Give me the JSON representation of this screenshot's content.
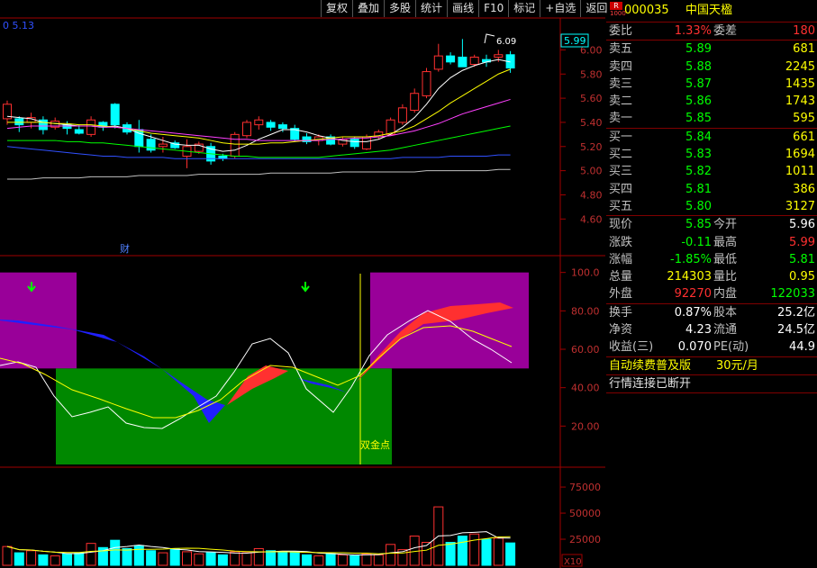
{
  "toolbar": [
    "复权",
    "叠加",
    "多股",
    "统计",
    "画线",
    "F10",
    "标记",
    "+自选",
    "返回"
  ],
  "chart": {
    "ma_label": "0  5.13",
    "last_price_tag": "5.99",
    "high_marker": "6.09",
    "finance_marker": "财",
    "price_axis": [
      "6.00",
      "5.80",
      "5.60",
      "5.40",
      "5.20",
      "5.00",
      "4.80",
      "4.60"
    ],
    "indicator_axis": [
      "100.0",
      "80.00",
      "60.00",
      "40.00",
      "20.00"
    ],
    "cross_label": "双金点",
    "volume_axis": [
      "75000",
      "50000",
      "25000"
    ],
    "volume_unit": "X10"
  },
  "stock": {
    "code": "000035",
    "name": "中国天楹",
    "badge_r": "R",
    "badge_n": "1000"
  },
  "ratio": {
    "l1": "委比",
    "v1": "1.33%",
    "l2": "委差",
    "v2": "180"
  },
  "asks": [
    {
      "label": "卖五",
      "price": "5.89",
      "vol": "681"
    },
    {
      "label": "卖四",
      "price": "5.88",
      "vol": "2245"
    },
    {
      "label": "卖三",
      "price": "5.87",
      "vol": "1435"
    },
    {
      "label": "卖二",
      "price": "5.86",
      "vol": "1743"
    },
    {
      "label": "卖一",
      "price": "5.85",
      "vol": "595"
    }
  ],
  "bids": [
    {
      "label": "买一",
      "price": "5.84",
      "vol": "661"
    },
    {
      "label": "买二",
      "price": "5.83",
      "vol": "1694"
    },
    {
      "label": "买三",
      "price": "5.82",
      "vol": "1011"
    },
    {
      "label": "买四",
      "price": "5.81",
      "vol": "386"
    },
    {
      "label": "买五",
      "price": "5.80",
      "vol": "3127"
    }
  ],
  "quote": [
    {
      "l1": "现价",
      "v1": "5.85",
      "c1": "green",
      "l2": "今开",
      "v2": "5.96",
      "c2": "white"
    },
    {
      "l1": "涨跌",
      "v1": "-0.11",
      "c1": "green",
      "l2": "最高",
      "v2": "5.99",
      "c2": "red"
    },
    {
      "l1": "涨幅",
      "v1": "-1.85%",
      "c1": "green",
      "l2": "最低",
      "v2": "5.81",
      "c2": "green"
    },
    {
      "l1": "总量",
      "v1": "214303",
      "c1": "yellow",
      "l2": "量比",
      "v2": "0.95",
      "c2": "yellow"
    },
    {
      "l1": "外盘",
      "v1": "92270",
      "c1": "red",
      "l2": "内盘",
      "v2": "122033",
      "c2": "green"
    }
  ],
  "fund": [
    {
      "l1": "换手",
      "v1": "0.87%",
      "l2": "股本",
      "v2": "25.2亿"
    },
    {
      "l1": "净资",
      "v1": "4.23",
      "l2": "流通",
      "v2": "24.5亿"
    },
    {
      "l1": "收益(三)",
      "v1": "0.070",
      "l2": "PE(动)",
      "v2": "44.9"
    }
  ],
  "notice": {
    "text": "自动续费普及版",
    "price": "30元/月"
  },
  "status": "行情连接已断开"
}
